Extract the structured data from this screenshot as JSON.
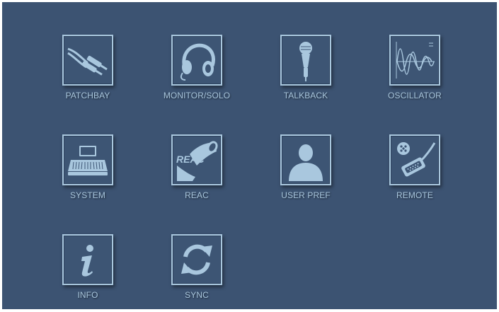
{
  "colors": {
    "background": "#3c5372",
    "icon": "#a9c7de"
  },
  "menu": {
    "items": [
      {
        "label": "PATCHBAY",
        "icon": "patch-cable-icon"
      },
      {
        "label": "MONITOR/SOLO",
        "icon": "headphones-icon"
      },
      {
        "label": "TALKBACK",
        "icon": "microphone-icon"
      },
      {
        "label": "OSCILLATOR",
        "icon": "waveform-icon"
      },
      {
        "label": "SYSTEM",
        "icon": "console-icon"
      },
      {
        "label": "REAC",
        "icon": "reac-connector-icon"
      },
      {
        "label": "USER PREF",
        "icon": "user-icon"
      },
      {
        "label": "REMOTE",
        "icon": "serial-connector-icon"
      },
      {
        "label": "INFO",
        "icon": "info-icon"
      },
      {
        "label": "SYNC",
        "icon": "sync-icon"
      }
    ]
  }
}
